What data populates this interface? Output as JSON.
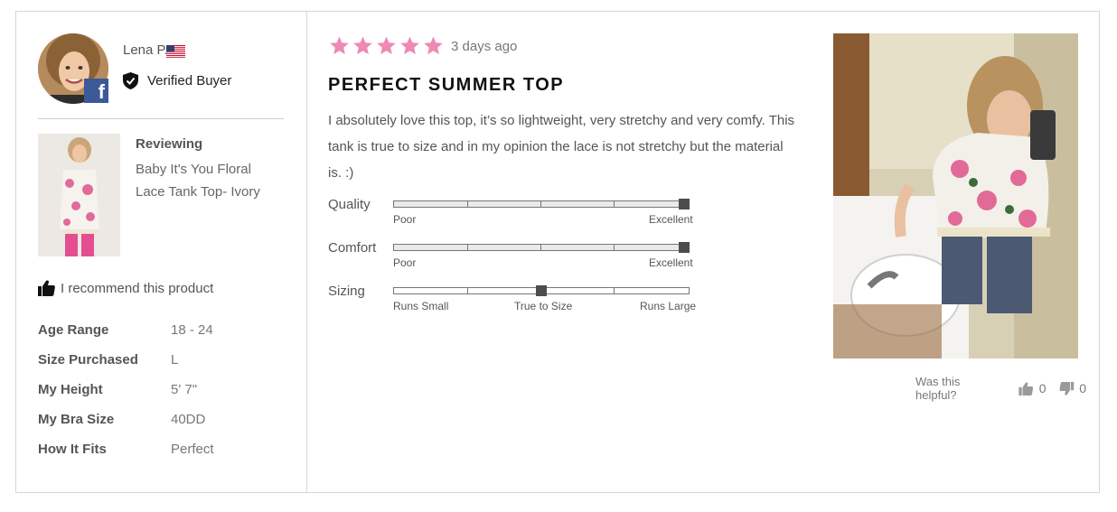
{
  "reviewer": {
    "name": "Lena P.",
    "verified_label": "Verified Buyer",
    "social_icon": "facebook-icon",
    "country_icon": "us-flag-icon"
  },
  "product": {
    "reviewing_label": "Reviewing",
    "name": "Baby It's You Floral Lace Tank Top- Ivory"
  },
  "recommend": {
    "text": "I recommend this product",
    "icon": "thumbs-up-icon"
  },
  "attributes": [
    {
      "label": "Age Range",
      "value": "18 - 24"
    },
    {
      "label": "Size Purchased",
      "value": "L"
    },
    {
      "label": "My Height",
      "value": "5' 7\""
    },
    {
      "label": "My Bra Size",
      "value": "40DD"
    },
    {
      "label": "How It Fits",
      "value": "Perfect"
    }
  ],
  "review": {
    "rating": 5,
    "rating_max": 5,
    "star_color": "#ef88b5",
    "date": "3 days ago",
    "title": "PERFECT SUMMER TOP",
    "body": "I absolutely love this top, it’s so lightweight, very stretchy and very comfy. This tank is true to size and in my opinion the lace is not stretchy but the material is. :)"
  },
  "sliders": [
    {
      "label": "Quality",
      "value": 1.0,
      "low": "Poor",
      "high": "Excellent"
    },
    {
      "label": "Comfort",
      "value": 1.0,
      "low": "Poor",
      "high": "Excellent"
    },
    {
      "label": "Sizing",
      "value": 0.5,
      "low": "Runs Small",
      "mid": "True to Size",
      "high": "Runs Large"
    }
  ],
  "helpful": {
    "question": "Was this helpful?",
    "up_count": "0",
    "down_count": "0"
  }
}
